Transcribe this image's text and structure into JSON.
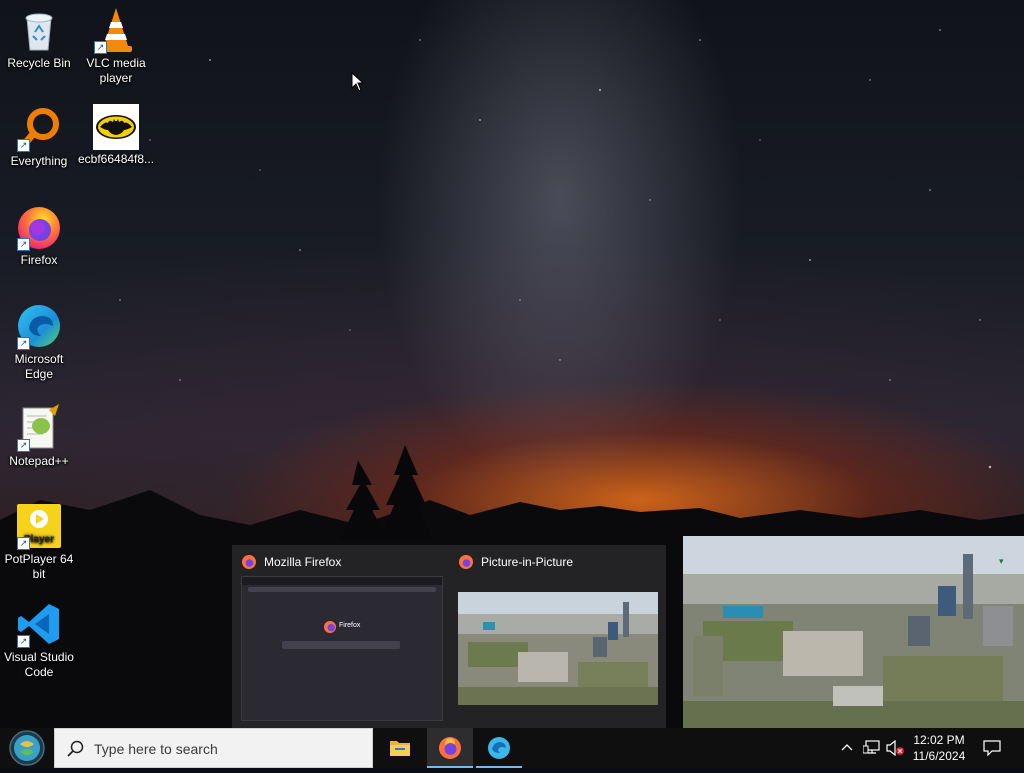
{
  "desktop": {
    "icons": [
      {
        "label": "Recycle Bin"
      },
      {
        "label": "VLC media player"
      },
      {
        "label": "Everything"
      },
      {
        "label": "ecbf66484f8..."
      },
      {
        "label": "Firefox"
      },
      {
        "label": "Microsoft Edge"
      },
      {
        "label": "Notepad++"
      },
      {
        "label": "PotPlayer 64 bit"
      },
      {
        "label": "Visual Studio Code"
      }
    ]
  },
  "thumbnails": [
    {
      "title": "Mozilla Firefox",
      "content_text": "Firefox"
    },
    {
      "title": "Picture-in-Picture"
    }
  ],
  "taskbar": {
    "search_placeholder": "Type here to search",
    "apps": [
      "file-explorer",
      "firefox",
      "edge-beta"
    ],
    "clock": {
      "time": "12:02 PM",
      "date": "11/6/2024"
    }
  },
  "colors": {
    "taskbar": "#0f0f10",
    "accent_indicator": "#76b9ed",
    "thumbnail_panel": "#242426"
  }
}
